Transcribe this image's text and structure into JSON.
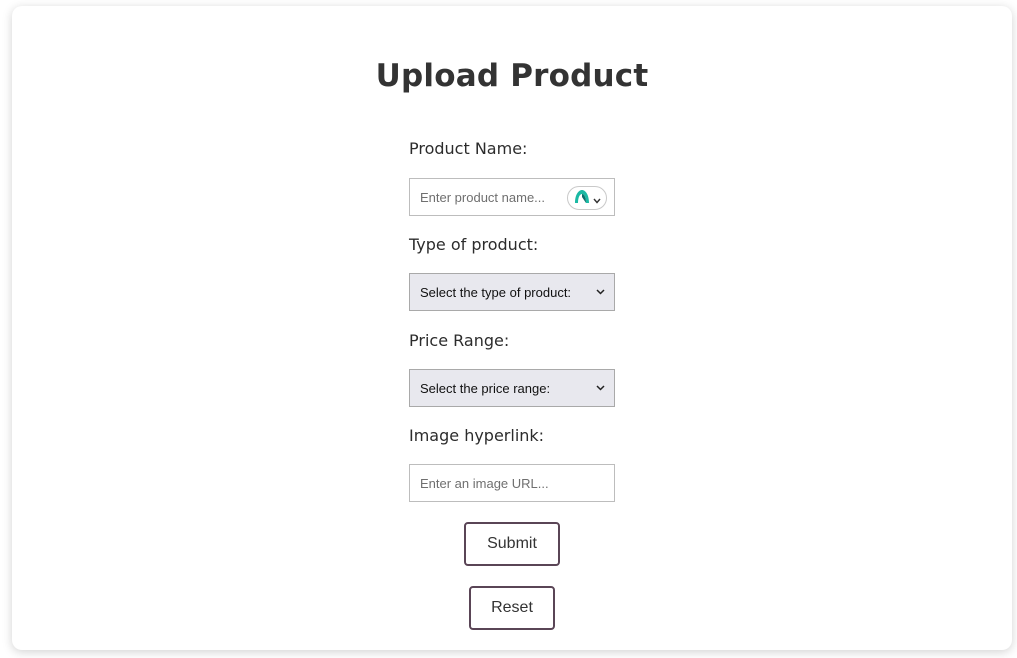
{
  "page": {
    "title": "Upload Product"
  },
  "form": {
    "product_name": {
      "label": "Product Name:",
      "placeholder": "Enter product name..."
    },
    "product_type": {
      "label": "Type of product:",
      "selected": "Select the type of product:"
    },
    "price_range": {
      "label": "Price Range:",
      "selected": "Select the price range:"
    },
    "image_link": {
      "label": "Image hyperlink:",
      "placeholder": "Enter an image URL..."
    },
    "submit_label": "Submit",
    "reset_label": "Reset"
  },
  "colors": {
    "badge_icon": "#1bb9a4",
    "button_border": "#5a4556",
    "select_bg": "#e8e8ee"
  }
}
